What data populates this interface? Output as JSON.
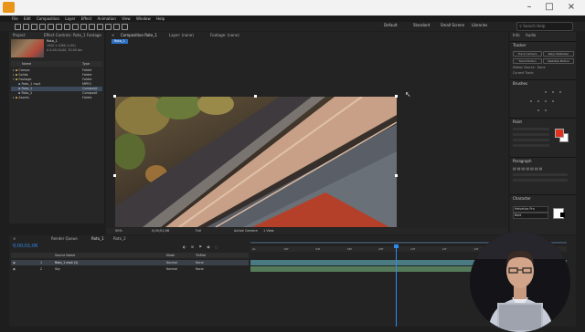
{
  "menu": [
    "File",
    "Edit",
    "Composition",
    "Layer",
    "Effect",
    "Animation",
    "View",
    "Window",
    "Help"
  ],
  "workspaces": [
    "Default",
    "Standard",
    "Small Screen",
    "Libraries"
  ],
  "search_placeholder": "Search Help",
  "project": {
    "tab": "Project",
    "tab2": "Effect Controls: Roto_1 Footage",
    "selected_name": "Roto_1",
    "info1": "1920 x 1080 (1.00)",
    "info2": "Δ 0;00;10;00, 30.00 fps",
    "columns": [
      "Name",
      "Type"
    ],
    "items": [
      {
        "name": "Comps",
        "type": "Folder"
      },
      {
        "name": "Solids",
        "type": "Folder"
      },
      {
        "name": "Footage",
        "type": "Folder"
      },
      {
        "name": "Roto_1 mp4",
        "type": "MPEG"
      },
      {
        "name": "Roto_1",
        "type": "Composit"
      },
      {
        "name": "Roto_2",
        "type": "Composit"
      },
      {
        "name": "Assets",
        "type": "Folder"
      }
    ]
  },
  "viewer": {
    "tab_comp": "Composition Roto_1",
    "tab_layer": "Layer: (none)",
    "tab_footage": "Footage: (none)",
    "comp_label": "Roto_1",
    "zoom": "50%",
    "timecode": "0;00;01;06",
    "resolution": "Full",
    "camera": "Active Camera",
    "view": "1 View"
  },
  "timeline": {
    "tab_render": "Render Queue",
    "tab_comp": "Roto_1",
    "tab_other": "Roto_2",
    "timecode": "0;00;01;06",
    "col_source": "Source Name",
    "col_mode": "Mode",
    "col_trk": "TrkMat",
    "layers": [
      {
        "num": "1",
        "name": "Roto_1 mp4 (1)",
        "mode": "Normal",
        "trk": "None"
      },
      {
        "num": "2",
        "name": "Sky",
        "mode": "Normal",
        "trk": "None"
      }
    ],
    "ruler": [
      "0s",
      "02f",
      "04f",
      "06f",
      "08f",
      "10f",
      "12f",
      "14f",
      "16f",
      "18f"
    ]
  },
  "right": {
    "info_tab": "Info",
    "audio_tab": "Audio",
    "tracker_title": "Tracker",
    "tracker_buttons": [
      "Track Camera",
      "Warp Stabilizer",
      "Track Motion",
      "Stabilize Motion"
    ],
    "motion_source_label": "Motion Source:",
    "motion_source_value": "None",
    "current_track_label": "Current Track:",
    "brushes_title": "Brushes",
    "paint_title": "Paint",
    "paragraph_title": "Paragraph",
    "character_title": "Character",
    "font_name": "Helvetica Pro",
    "font_style": "Bold",
    "paint_fg_color": "#e0301e",
    "accent": "#2d8ceb"
  }
}
